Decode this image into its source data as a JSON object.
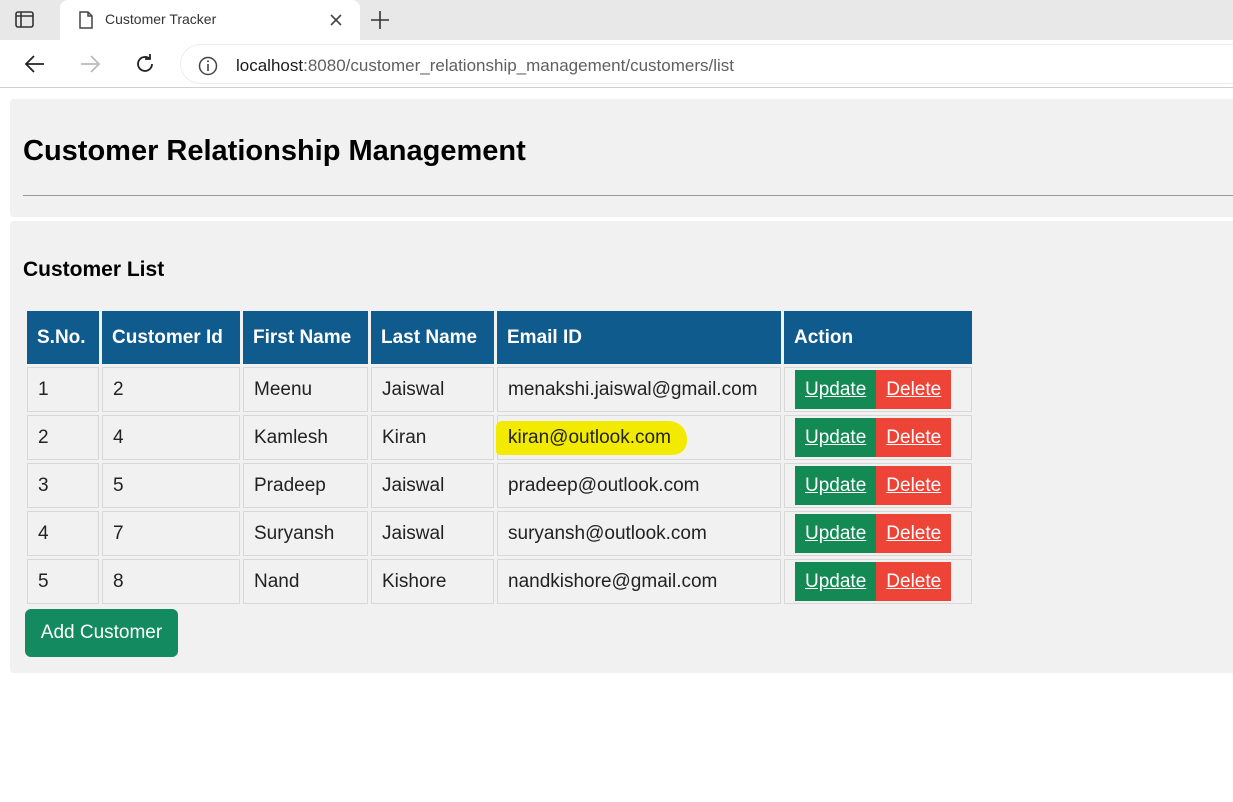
{
  "browser": {
    "tab_title": "Customer Tracker",
    "url_host": "localhost",
    "url_path": ":8080/customer_relationship_management/customers/list"
  },
  "page": {
    "title": "Customer Relationship Management",
    "list_title": "Customer List",
    "add_button": "Add Customer"
  },
  "table": {
    "headers": [
      "S.No.",
      "Customer Id",
      "First Name",
      "Last Name",
      "Email ID",
      "Action"
    ],
    "rows": [
      {
        "sno": "1",
        "id": "2",
        "first": "Meenu",
        "last": "Jaiswal",
        "email": "menakshi.jaiswal@gmail.com"
      },
      {
        "sno": "2",
        "id": "4",
        "first": "Kamlesh",
        "last": "Kiran",
        "email": "kiran@outlook.com"
      },
      {
        "sno": "3",
        "id": "5",
        "first": "Pradeep",
        "last": "Jaiswal",
        "email": "pradeep@outlook.com"
      },
      {
        "sno": "4",
        "id": "7",
        "first": "Suryansh",
        "last": "Jaiswal",
        "email": "suryansh@outlook.com"
      },
      {
        "sno": "5",
        "id": "8",
        "first": "Nand",
        "last": "Kishore",
        "email": "nandkishore@gmail.com"
      }
    ],
    "update_label": "Update ",
    "delete_label": "Delete"
  },
  "colors": {
    "header_bg": "#0f5b8e",
    "update_bg": "#138a53",
    "delete_bg": "#ee4438",
    "highlight": "#f2ea00"
  },
  "icons": [
    "tab-actions-icon",
    "page-icon",
    "close-icon",
    "plus-icon",
    "back-arrow-icon",
    "forward-arrow-icon",
    "reload-icon",
    "info-icon"
  ]
}
